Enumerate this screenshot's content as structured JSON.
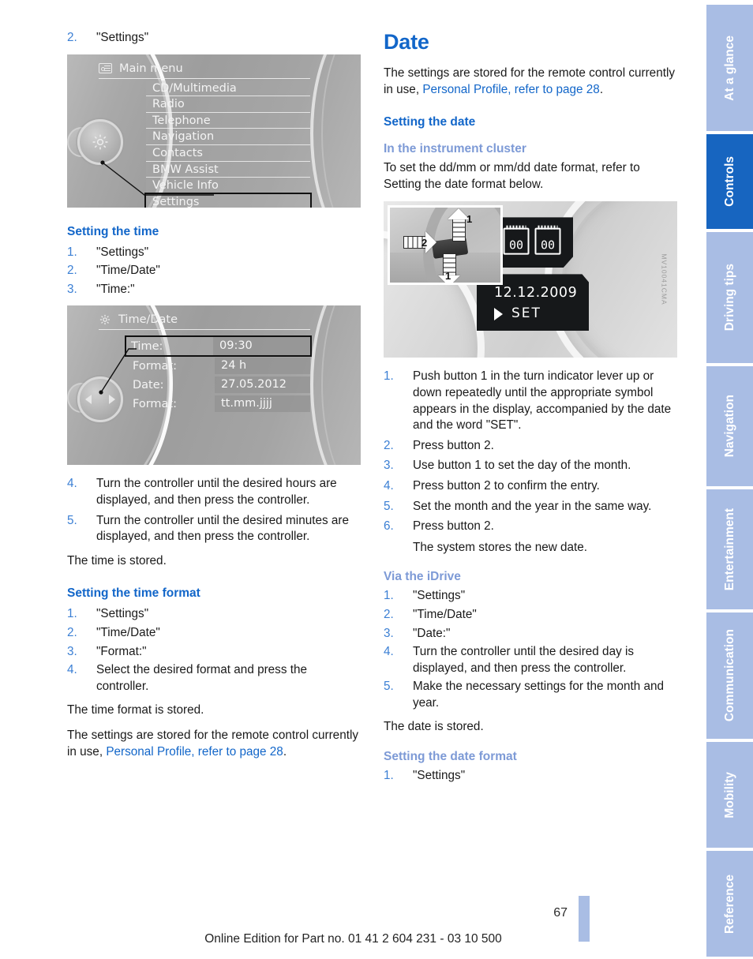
{
  "page": {
    "number": "67",
    "footer_note": "Online Edition for Part no. 01 41 2 604 231 - 03 10 500"
  },
  "left_column": {
    "intro_step": {
      "num": "2.",
      "text": "\"Settings\""
    },
    "figure_main_menu": {
      "header_title": "Main menu",
      "header_icon": "menu-list-icon",
      "knob_icon": "gear-icon",
      "items": [
        "CD/Multimedia",
        "Radio",
        "Telephone",
        "Navigation",
        "Contacts",
        "BMW Assist",
        "Vehicle Info",
        "Settings"
      ],
      "selected_item": "Settings"
    },
    "setting_the_time": {
      "heading": "Setting the time",
      "steps": [
        {
          "num": "1.",
          "text": "\"Settings\""
        },
        {
          "num": "2.",
          "text": "\"Time/Date\""
        },
        {
          "num": "3.",
          "text": "\"Time:\""
        }
      ]
    },
    "figure_time_date": {
      "header_title": "Time/Date",
      "header_icon": "gear-icon",
      "knob_icon": "left-right-arrows-icon",
      "rows": [
        {
          "label": "Time:",
          "value": "09:30",
          "selected": true
        },
        {
          "label": "Format:",
          "value": "24 h",
          "selected": false
        },
        {
          "label": "Date:",
          "value": "27.05.2012",
          "selected": false
        },
        {
          "label": "Format:",
          "value": "tt.mm.jjjj",
          "selected": false
        }
      ]
    },
    "setting_the_time_steps_cont": [
      {
        "num": "4.",
        "text": "Turn the controller until the desired hours are displayed, and then press the controller."
      },
      {
        "num": "5.",
        "text": "Turn the controller until the desired minutes are displayed, and then press the controller."
      }
    ],
    "time_stored_note": "The time is stored.",
    "setting_the_time_format": {
      "heading": "Setting the time format",
      "steps": [
        {
          "num": "1.",
          "text": "\"Settings\""
        },
        {
          "num": "2.",
          "text": "\"Time/Date\""
        },
        {
          "num": "3.",
          "text": "\"Format:\""
        },
        {
          "num": "4.",
          "text": "Select the desired format and press the controller."
        }
      ]
    },
    "time_format_stored_note": "The time format is stored.",
    "remote_control_note": {
      "lead": "The settings are stored for the remote control currently in use, ",
      "link": "Personal Profile, refer to page 28",
      "tail": "."
    }
  },
  "right_column": {
    "chapter_title": "Date",
    "remote_control_note": {
      "lead": "The settings are stored for the remote control currently in use, ",
      "link": "Personal Profile, refer to page 28",
      "tail": "."
    },
    "setting_the_date": {
      "heading": "Setting the date"
    },
    "in_the_instrument_cluster": {
      "heading": "In the instrument cluster",
      "intro": "To set the dd/mm or mm/dd date format, refer to Setting the date format below.",
      "figure": {
        "lcd_date": "12.12.2009",
        "lcd_word": "SET",
        "calendar_left": "00",
        "calendar_right": "00",
        "callout_1": "1",
        "callout_1b": "1",
        "callout_2": "2",
        "figure_code": "MV10041CMA"
      },
      "steps": [
        {
          "num": "1.",
          "text": "Push button 1 in the turn indicator lever up or down repeatedly until the appropriate symbol appears in the display, accompanied by the date and the word \"SET\"."
        },
        {
          "num": "2.",
          "text": "Press button 2."
        },
        {
          "num": "3.",
          "text": "Use button 1 to set the day of the month."
        },
        {
          "num": "4.",
          "text": "Press button 2 to confirm the entry."
        },
        {
          "num": "5.",
          "text": "Set the month and the year in the same way."
        },
        {
          "num": "6.",
          "text": "Press button 2.",
          "sub": "The system stores the new date."
        }
      ]
    },
    "via_the_idrive": {
      "heading": "Via the iDrive",
      "steps": [
        {
          "num": "1.",
          "text": "\"Settings\""
        },
        {
          "num": "2.",
          "text": "\"Time/Date\""
        },
        {
          "num": "3.",
          "text": "\"Date:\""
        },
        {
          "num": "4.",
          "text": "Turn the controller until the desired day is displayed, and then press the controller."
        },
        {
          "num": "5.",
          "text": "Make the necessary settings for the month and year."
        }
      ],
      "stored_note": "The date is stored."
    },
    "setting_the_date_format": {
      "heading": "Setting the date format",
      "steps": [
        {
          "num": "1.",
          "text": "\"Settings\""
        }
      ]
    }
  },
  "tabs": [
    {
      "label": "At a glance",
      "active": false
    },
    {
      "label": "Controls",
      "active": true
    },
    {
      "label": "Driving tips",
      "active": false
    },
    {
      "label": "Navigation",
      "active": false
    },
    {
      "label": "Entertainment",
      "active": false
    },
    {
      "label": "Communication",
      "active": false
    },
    {
      "label": "Mobility",
      "active": false
    },
    {
      "label": "Reference",
      "active": false
    }
  ],
  "colors": {
    "accent_blue": "#1266c9",
    "subheading_blue": "#7d9ad6",
    "tab_inactive": "#a9bde4",
    "tab_active": "#1765c0"
  }
}
